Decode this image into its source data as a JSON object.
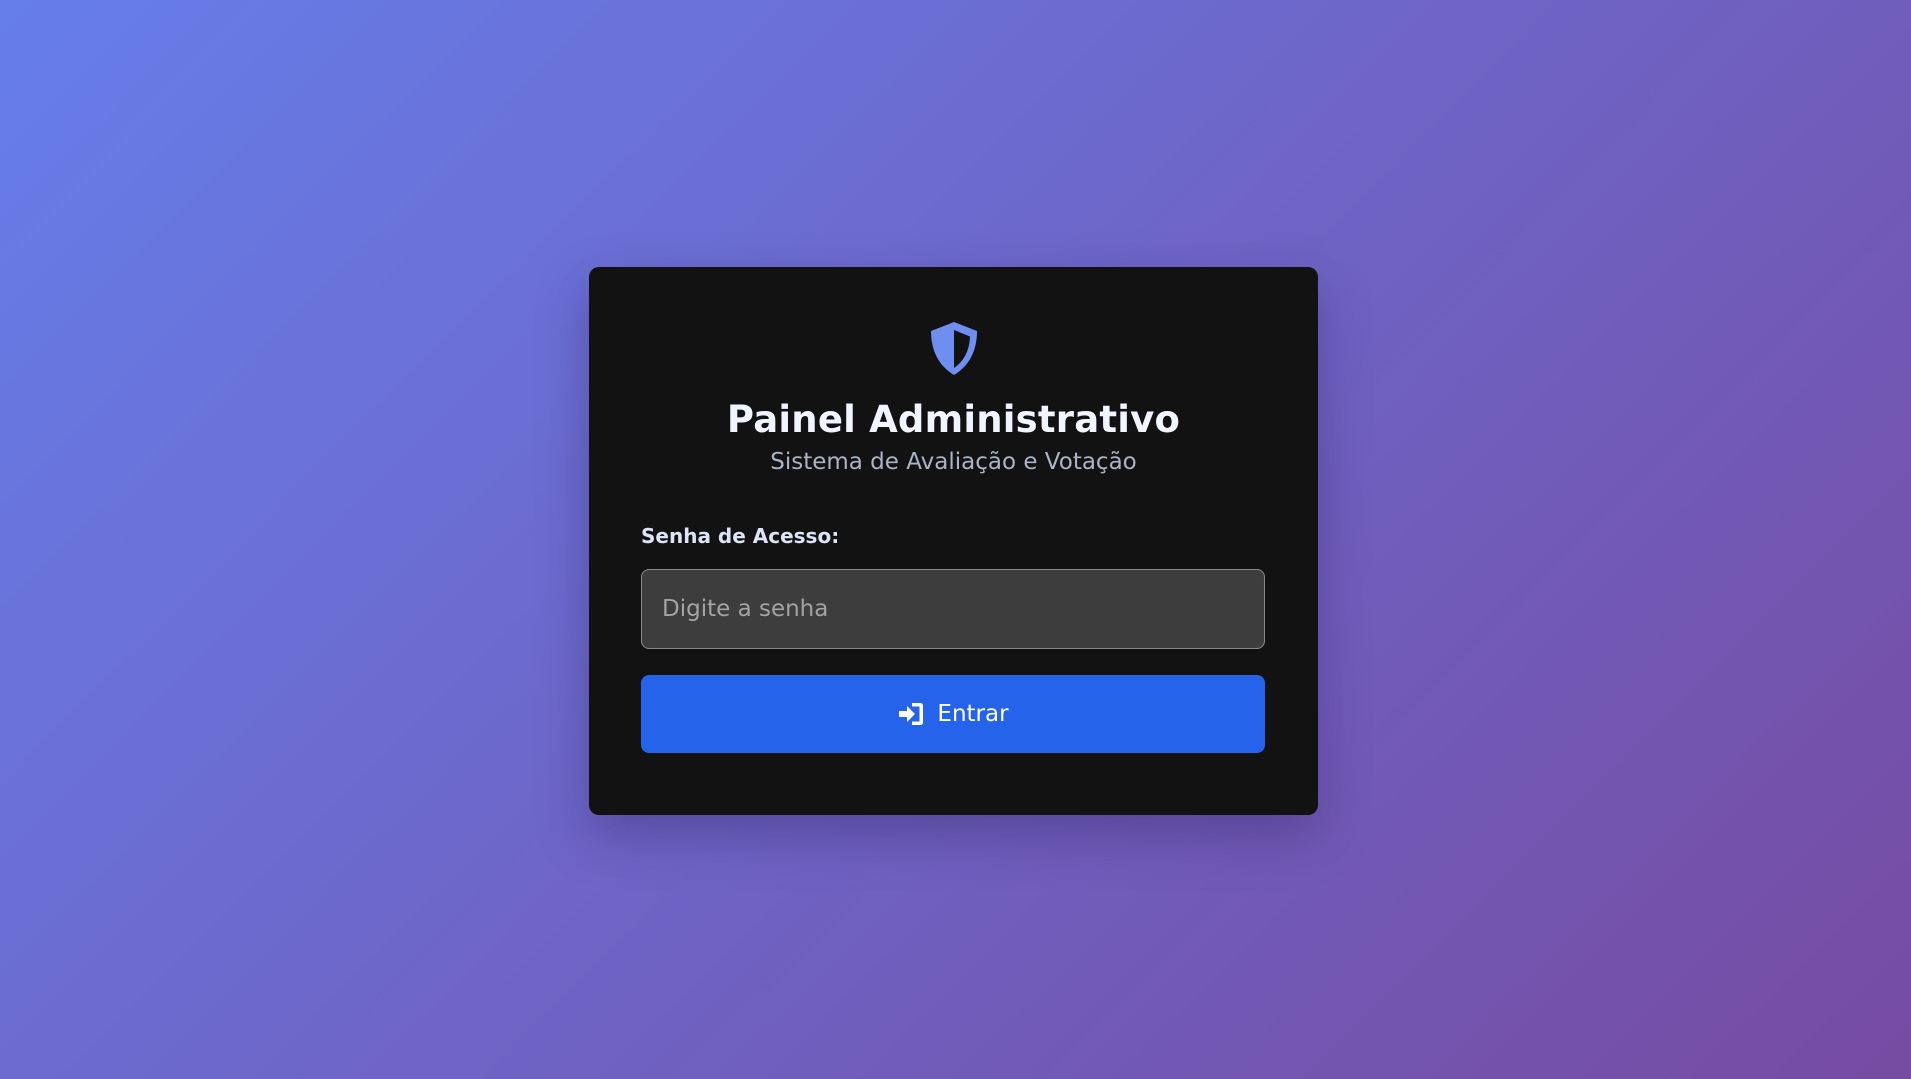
{
  "login": {
    "logo_icon": "shield-halved-icon",
    "title": "Painel Administrativo",
    "subtitle": "Sistema de Avaliação e Votação",
    "password_label": "Senha de Acesso:",
    "password_placeholder": "Digite a senha",
    "password_value": "",
    "submit_icon": "sign-in-icon",
    "submit_label": "Entrar"
  },
  "colors": {
    "background_gradient_start": "#667eea",
    "background_gradient_end": "#764ba2",
    "card_background": "#121212",
    "shield_accent": "#6f8ff0",
    "button_primary": "#2563eb",
    "input_background": "#3d3d3d"
  }
}
